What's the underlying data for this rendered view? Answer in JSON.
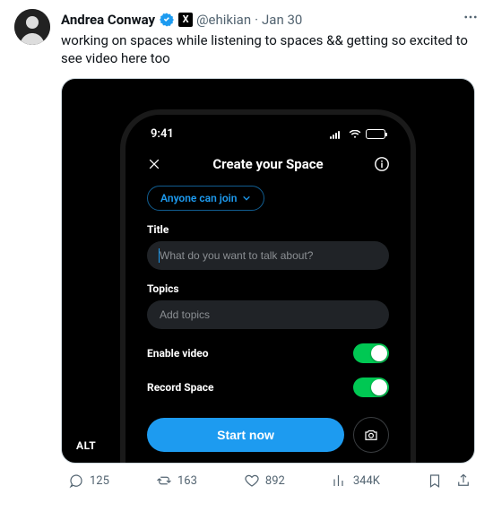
{
  "author": {
    "display_name": "Andrea Conway",
    "handle": "@ehikian",
    "date": "Jan 30",
    "x_badge": "X"
  },
  "tweet_text": "working on spaces while listening to spaces && getting so excited to see video here too",
  "alt_label": "ALT",
  "phone": {
    "time": "9:41",
    "header_title": "Create your Space",
    "privacy_pill": "Anyone can join",
    "title_label": "Title",
    "title_placeholder": "What do you want to talk about?",
    "topics_label": "Topics",
    "topics_placeholder": "Add topics",
    "enable_video_label": "Enable video",
    "record_space_label": "Record Space",
    "start_button": "Start now"
  },
  "actions": {
    "replies": "125",
    "reposts": "163",
    "likes": "892",
    "views": "344K"
  }
}
